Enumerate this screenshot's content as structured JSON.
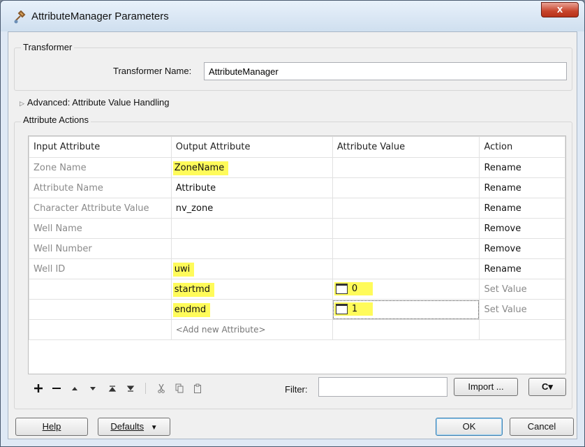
{
  "window": {
    "title": "AttributeManager Parameters",
    "close_label": "x"
  },
  "transformer": {
    "group_label": "Transformer",
    "name_label": "Transformer Name:",
    "name_value": "AttributeManager"
  },
  "advanced": {
    "label": "Advanced: Attribute Value Handling"
  },
  "actions": {
    "group_label": "Attribute Actions",
    "columns": [
      "Input Attribute",
      "Output Attribute",
      "Attribute Value",
      "Action"
    ],
    "rows": [
      {
        "input": "Zone Name",
        "output": "ZoneName",
        "value": "",
        "action": "Rename"
      },
      {
        "input": "Attribute Name",
        "output": "Attribute",
        "value": "",
        "action": "Rename"
      },
      {
        "input": "Character Attribute Value",
        "output": "nv_zone",
        "value": "",
        "action": "Rename"
      },
      {
        "input": "Well Name",
        "output": "",
        "value": "",
        "action": "Remove"
      },
      {
        "input": "Well Number",
        "output": "",
        "value": "",
        "action": "Remove"
      },
      {
        "input": "Well ID",
        "output": "uwi",
        "value": "",
        "action": "Rename"
      },
      {
        "input": "",
        "output": "startmd",
        "value": "0",
        "action": "Set Value"
      },
      {
        "input": "",
        "output": "endmd",
        "value": "1",
        "action": "Set Value"
      }
    ],
    "add_new": "<Add new Attribute>"
  },
  "toolbar": {
    "icons": [
      "add-icon",
      "remove-icon",
      "move-up-icon",
      "move-down-icon",
      "move-to-top-icon",
      "move-to-bottom-icon",
      "cut-icon",
      "copy-icon",
      "paste-icon"
    ],
    "filter_label": "Filter:",
    "filter_value": "",
    "import_label": "Import ...",
    "refresh_label": "C▾"
  },
  "footer": {
    "help_label": "Help",
    "defaults_label": "Defaults",
    "ok_label": "OK",
    "cancel_label": "Cancel"
  },
  "colors": {
    "highlight": "#fffb5a",
    "titlebar": "#d7e4f2",
    "close_button": "#c7442c"
  }
}
